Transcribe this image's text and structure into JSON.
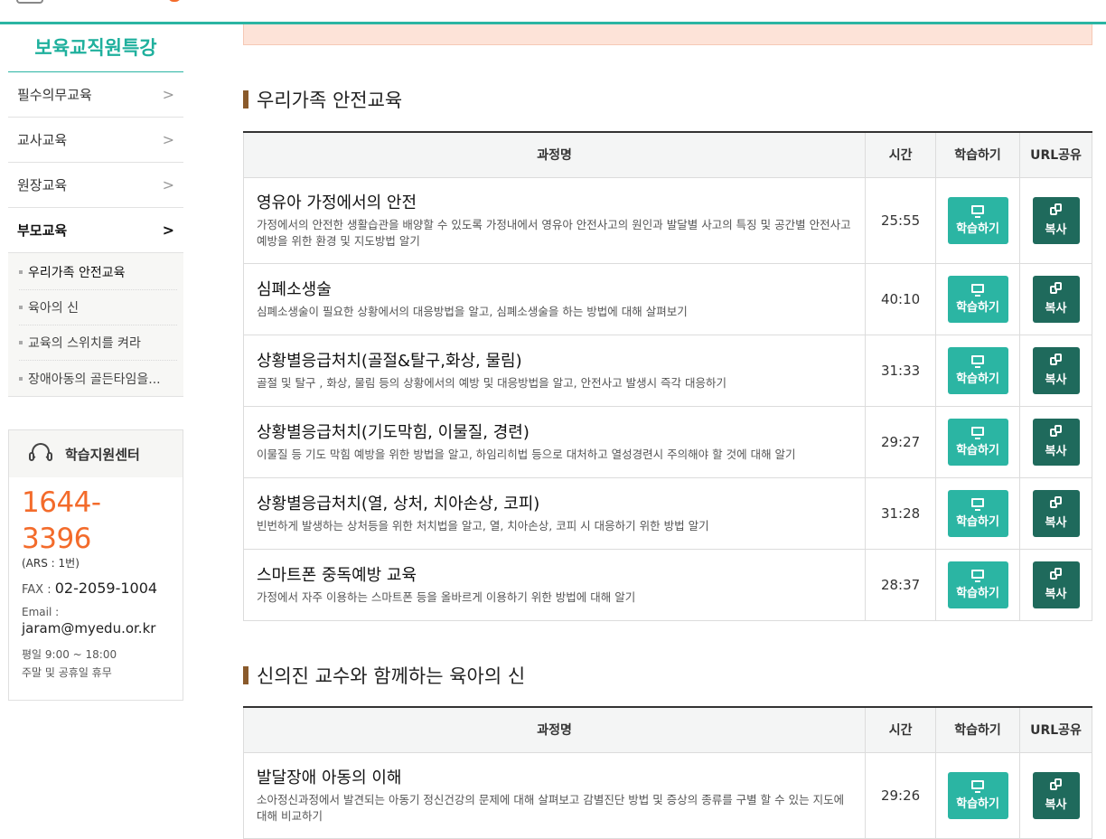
{
  "sidebar": {
    "title": "보육교직원특강",
    "items": [
      {
        "label": "필수의무교육",
        "chevron": ">"
      },
      {
        "label": "교사교육",
        "chevron": ">"
      },
      {
        "label": "원장교육",
        "chevron": ">"
      },
      {
        "label": "부모교육",
        "chevron": ">"
      }
    ],
    "subitems": [
      {
        "label": "우리가족 안전교육"
      },
      {
        "label": "육아의 신"
      },
      {
        "label": "교육의 스위치를 켜라"
      },
      {
        "label": "장애아동의 골든타임을..."
      }
    ]
  },
  "support": {
    "title": "학습지원센터",
    "phone": "1644-3396",
    "ars": "(ARS : 1번)",
    "fax_label": "FAX : ",
    "fax": "02-2059-1004",
    "email_label": "Email :",
    "email": "jaram@myedu.or.kr",
    "hours_weekday": "평일 9:00 ~ 18:00",
    "hours_weekend": "주말 및 공휴일 휴무"
  },
  "table_headers": {
    "name": "과정명",
    "time": "시간",
    "study": "학습하기",
    "url": "URL공유"
  },
  "buttons": {
    "study": "학습하기",
    "copy": "복사"
  },
  "sections": [
    {
      "title": "우리가족 안전교육",
      "courses": [
        {
          "title": "영유아 가정에서의 안전",
          "desc": "가정에서의 안전한 생활습관을 배양할 수 있도록 가정내에서 영유아 안전사고의 원인과 발달별 사고의 특징 및 공간별 안전사고 예방을 위한 환경 및 지도방법 알기",
          "time": "25:55"
        },
        {
          "title": "심폐소생술",
          "desc": "심폐소생술이 필요한 상황에서의 대응방법을 알고, 심폐소생술을 하는 방법에 대해 살펴보기",
          "time": "40:10"
        },
        {
          "title": "상황별응급처치(골절&탈구,화상, 물림)",
          "desc": "골절 및 탈구 , 화상, 물림 등의 상황에서의 예방 및 대응방법을 알고, 안전사고 발생시 즉각 대응하기",
          "time": "31:33"
        },
        {
          "title": "상황별응급처치(기도막힘, 이물질, 경련)",
          "desc": "이물질 등 기도 막힘 예방을 위한 방법을 알고, 하임리히법 등으로 대처하고 열성경련시 주의해야 할 것에 대해 알기",
          "time": "29:27"
        },
        {
          "title": "상황별응급처치(열, 상처, 치아손상, 코피)",
          "desc": "빈번하게 발생하는 상처등을 위한 처치법을 알고, 열, 치아손상, 코피 시 대응하기 위한 방법 알기",
          "time": "31:28"
        },
        {
          "title": "스마트폰 중독예방 교육",
          "desc": "가정에서 자주 이용하는 스마트폰 등을 올바르게 이용하기 위한 방법에 대해 알기",
          "time": "28:37"
        }
      ]
    },
    {
      "title": "신의진 교수와 함께하는 육아의 신",
      "courses": [
        {
          "title": "발달장애 아동의 이해",
          "desc": "소아정신과정에서 발견되는 아동기 정신건강의 문제에 대해 살펴보고 감별진단 방법 및 증상의 종류를 구별 할 수 있는 지도에 대해 비교하기",
          "time": "29:26"
        }
      ]
    }
  ]
}
